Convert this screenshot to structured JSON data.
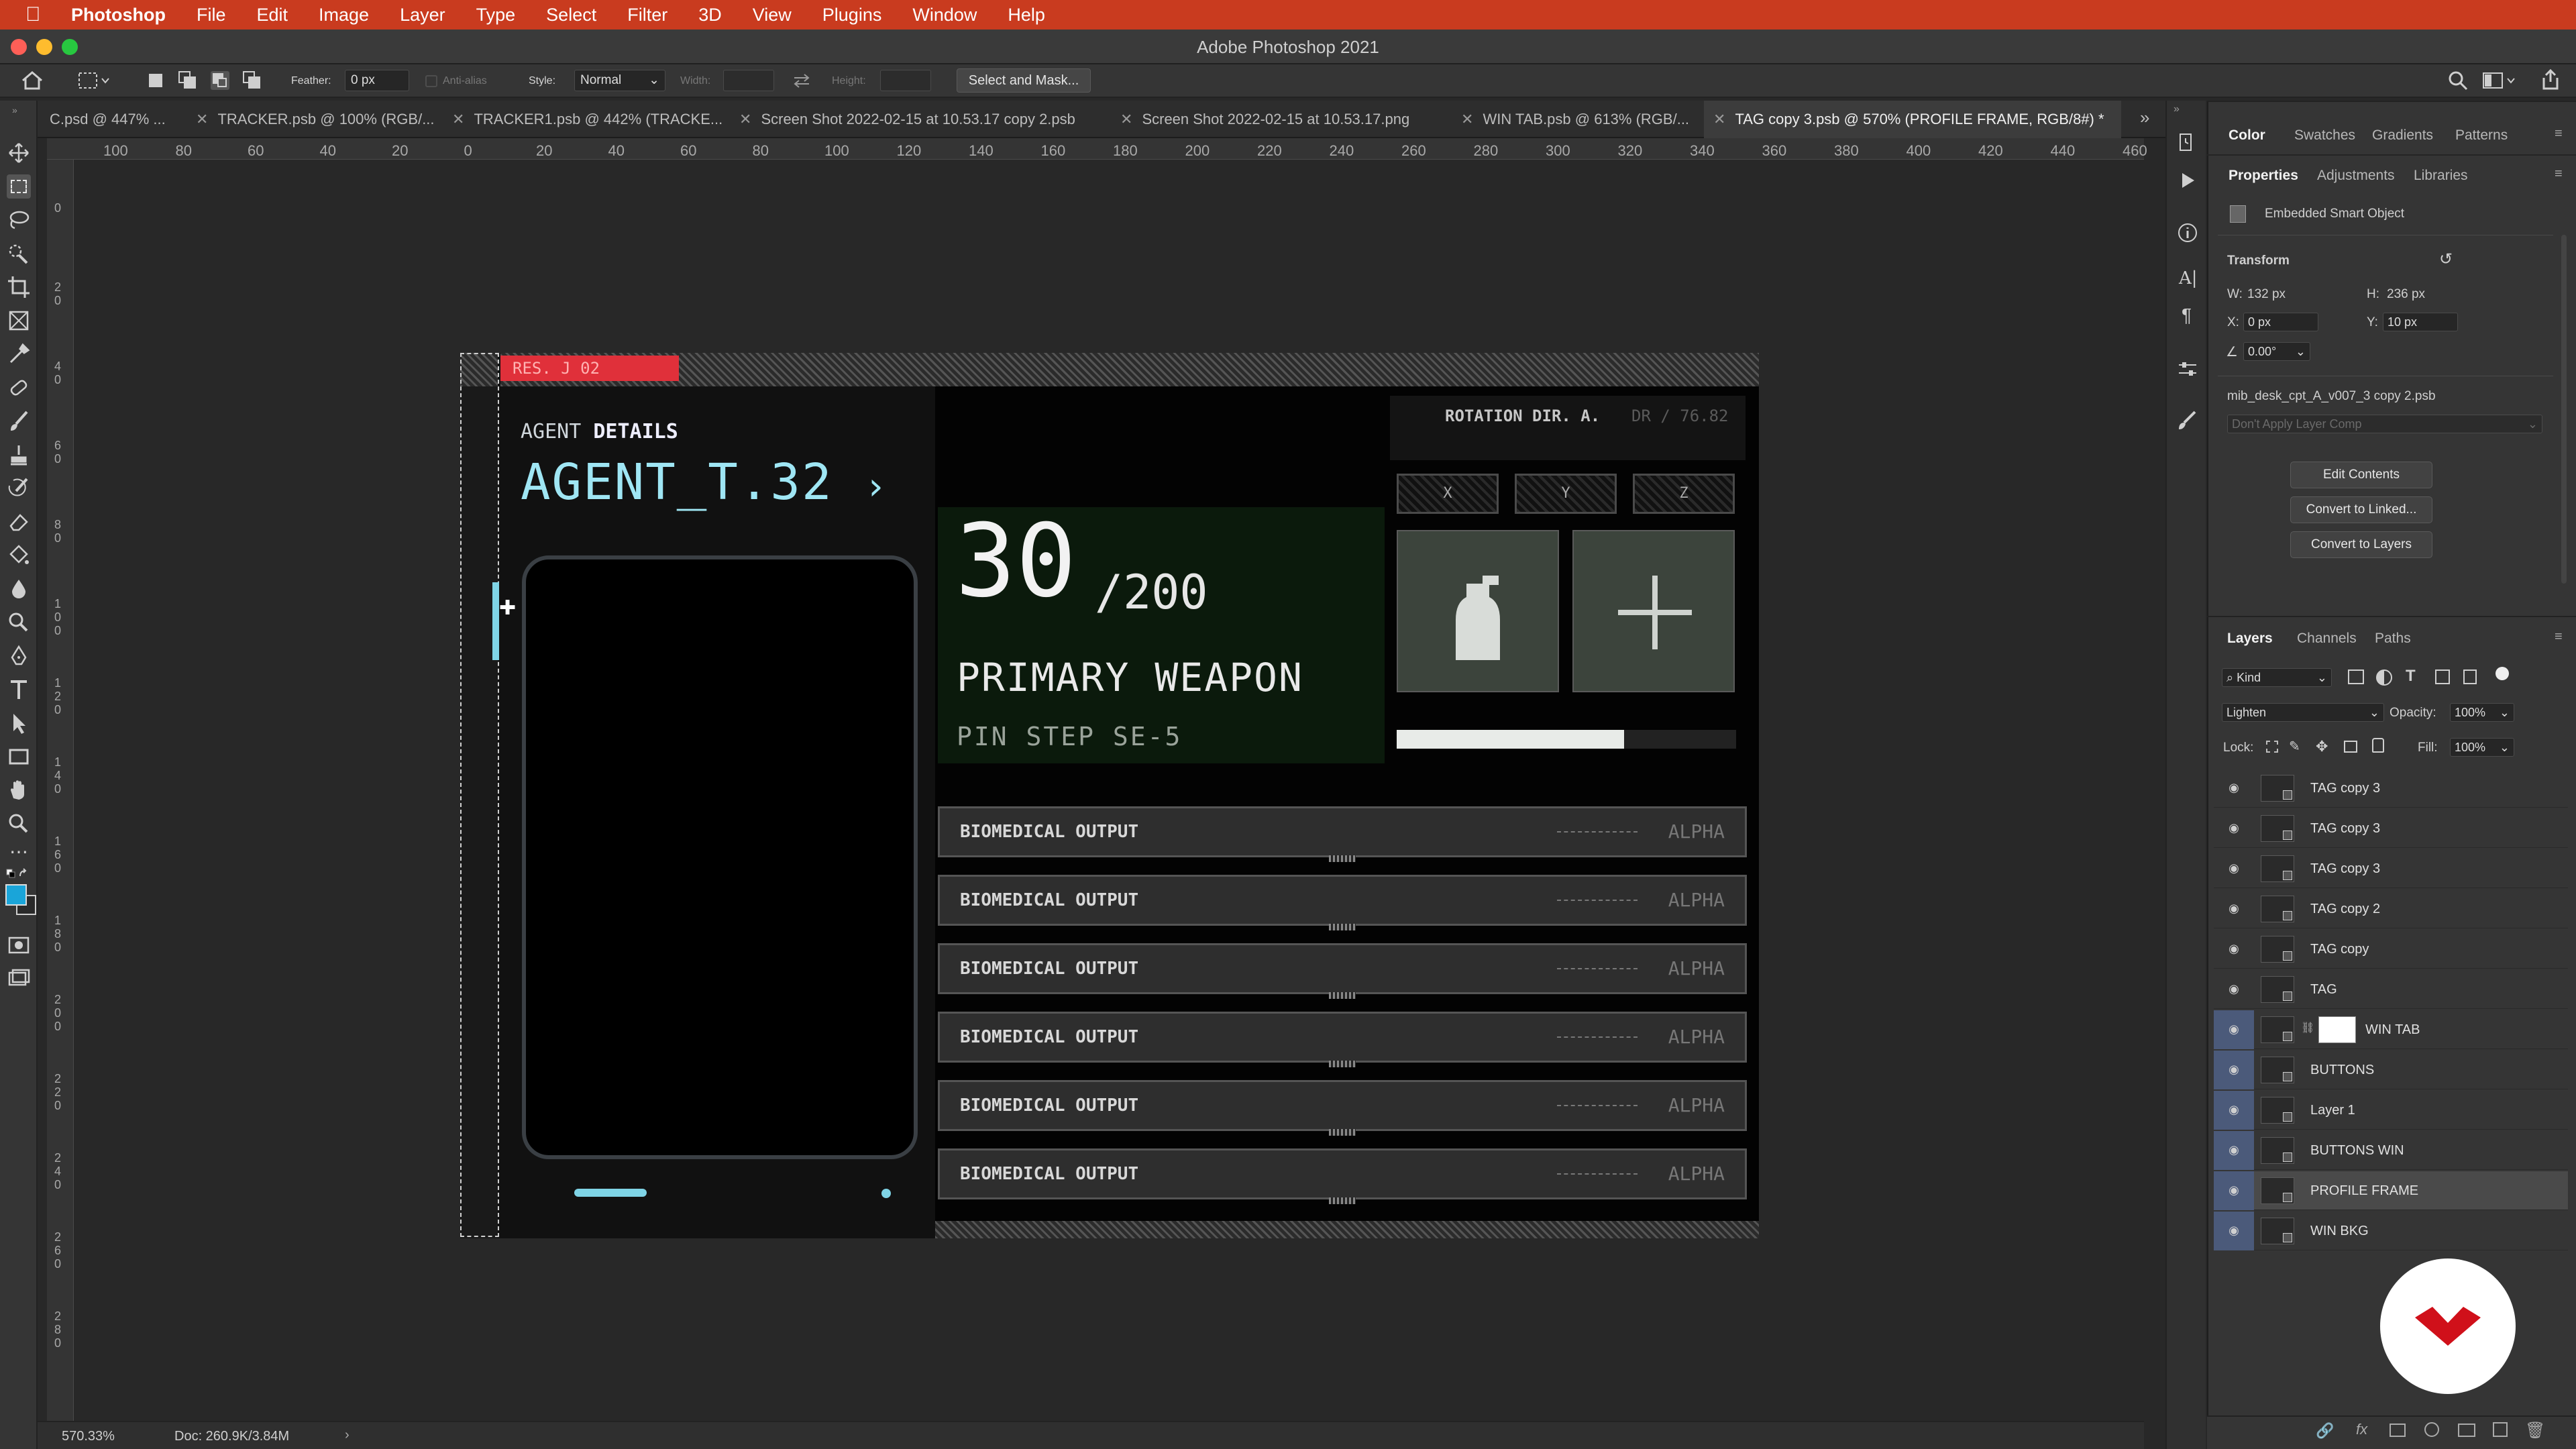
{
  "menubar": {
    "apple_icon": "apple-icon",
    "items": [
      "Photoshop",
      "File",
      "Edit",
      "Image",
      "Layer",
      "Type",
      "Select",
      "Filter",
      "3D",
      "View",
      "Plugins",
      "Window",
      "Help"
    ]
  },
  "window": {
    "title": "Adobe Photoshop 2021"
  },
  "options": {
    "feather_label": "Feather:",
    "feather_value": "0 px",
    "antialias_label": "Anti-alias",
    "style_label": "Style:",
    "style_value": "Normal",
    "width_label": "Width:",
    "height_label": "Height:",
    "select_mask": "Select and Mask..."
  },
  "tabs": [
    {
      "label": "C.psd @ 447% ..."
    },
    {
      "label": "TRACKER.psb @ 100% (RGB/..."
    },
    {
      "label": "TRACKER1.psb @ 442% (TRACKE..."
    },
    {
      "label": "Screen Shot 2022-02-15 at 10.53.17 copy 2.psb"
    },
    {
      "label": "Screen Shot 2022-02-15 at 10.53.17.png"
    },
    {
      "label": "WIN TAB.psb @ 613% (RGB/..."
    },
    {
      "label": "TAG copy 3.psb @ 570% (PROFILE FRAME, RGB/8#) *"
    }
  ],
  "ruler": {
    "top": [
      "100",
      "80",
      "60",
      "40",
      "20",
      "0",
      "20",
      "40",
      "60",
      "80",
      "100",
      "120",
      "140",
      "160",
      "180",
      "200",
      "220",
      "240",
      "260",
      "280",
      "300",
      "320",
      "340",
      "360",
      "380",
      "400",
      "420",
      "440",
      "460"
    ],
    "left": [
      "0",
      "2 0",
      "4 0",
      "6 0",
      "8 0",
      "1 0 0",
      "1 2 0",
      "1 4 0",
      "1 6 0",
      "1 8 0",
      "2 0 0",
      "2 2 0",
      "2 4 0",
      "2 6 0",
      "2 8 0"
    ]
  },
  "artwork": {
    "res_tag": "RES. J 02",
    "agent_label_a": "AGENT",
    "agent_label_b": "DETAILS",
    "agent_name": "AGENT_T.32",
    "agent_chevron": "›",
    "rotation_label": "ROTATION DIR. A.",
    "rotation_value": "DR / 76.82",
    "axis": [
      "X",
      "Y",
      "Z"
    ],
    "ammo_count": "30",
    "ammo_total": "/200",
    "weapon_title": "PRIMARY WEAPON",
    "weapon_sub": "PIN STEP SE-5",
    "weapon_bar_fill": 0.67,
    "bars": [
      {
        "label": "BIOMEDICAL OUTPUT",
        "tag": "ALPHA"
      },
      {
        "label": "BIOMEDICAL OUTPUT",
        "tag": "ALPHA"
      },
      {
        "label": "BIOMEDICAL OUTPUT",
        "tag": "ALPHA"
      },
      {
        "label": "BIOMEDICAL OUTPUT",
        "tag": "ALPHA"
      },
      {
        "label": "BIOMEDICAL OUTPUT",
        "tag": "ALPHA"
      },
      {
        "label": "BIOMEDICAL OUTPUT",
        "tag": "ALPHA"
      }
    ],
    "accent": "#e0303a",
    "cyan": "#7fd4e6"
  },
  "status": {
    "zoom": "570.33%",
    "doc": "Doc: 260.9K/3.84M"
  },
  "panels": {
    "top_tabs": [
      "Color",
      "Swatches",
      "Gradients",
      "Patterns"
    ],
    "prop_tabs": [
      "Properties",
      "Adjustments",
      "Libraries"
    ],
    "object_type": "Embedded Smart Object",
    "transform_title": "Transform",
    "w_label": "W:",
    "w_value": "132 px",
    "h_label": "H:",
    "h_value": "236 px",
    "x_label": "X:",
    "x_value": "0 px",
    "y_label": "Y:",
    "y_value": "10 px",
    "angle_value": "0.00°",
    "filename": "mib_desk_cpt_A_v007_3 copy 2.psb",
    "layer_comp": "Don't Apply Layer Comp",
    "btn_edit": "Edit Contents",
    "btn_convert_linked": "Convert to Linked...",
    "btn_convert_layers": "Convert to Layers",
    "layer_tabs": [
      "Layers",
      "Channels",
      "Paths"
    ],
    "kind_label": "Kind",
    "blend_mode": "Lighten",
    "opacity_label": "Opacity:",
    "opacity_value": "100%",
    "lock_label": "Lock:",
    "fill_label": "Fill:",
    "fill_value": "100%"
  },
  "layers": [
    {
      "name": "TAG copy 3",
      "linked": false,
      "selected": false
    },
    {
      "name": "TAG copy 3",
      "linked": false,
      "selected": false
    },
    {
      "name": "TAG copy 3",
      "linked": false,
      "selected": false
    },
    {
      "name": "TAG copy 2",
      "linked": false,
      "selected": false
    },
    {
      "name": "TAG copy",
      "linked": false,
      "selected": false
    },
    {
      "name": "TAG",
      "linked": false,
      "selected": false
    },
    {
      "name": "WIN TAB",
      "linked": true,
      "selected": false
    },
    {
      "name": "BUTTONS",
      "linked": true,
      "selected": false
    },
    {
      "name": "Layer 1",
      "linked": true,
      "selected": false
    },
    {
      "name": "BUTTONS WIN",
      "linked": true,
      "selected": false
    },
    {
      "name": "PROFILE FRAME",
      "linked": true,
      "selected": true
    },
    {
      "name": "WIN BKG",
      "linked": true,
      "selected": false
    }
  ]
}
